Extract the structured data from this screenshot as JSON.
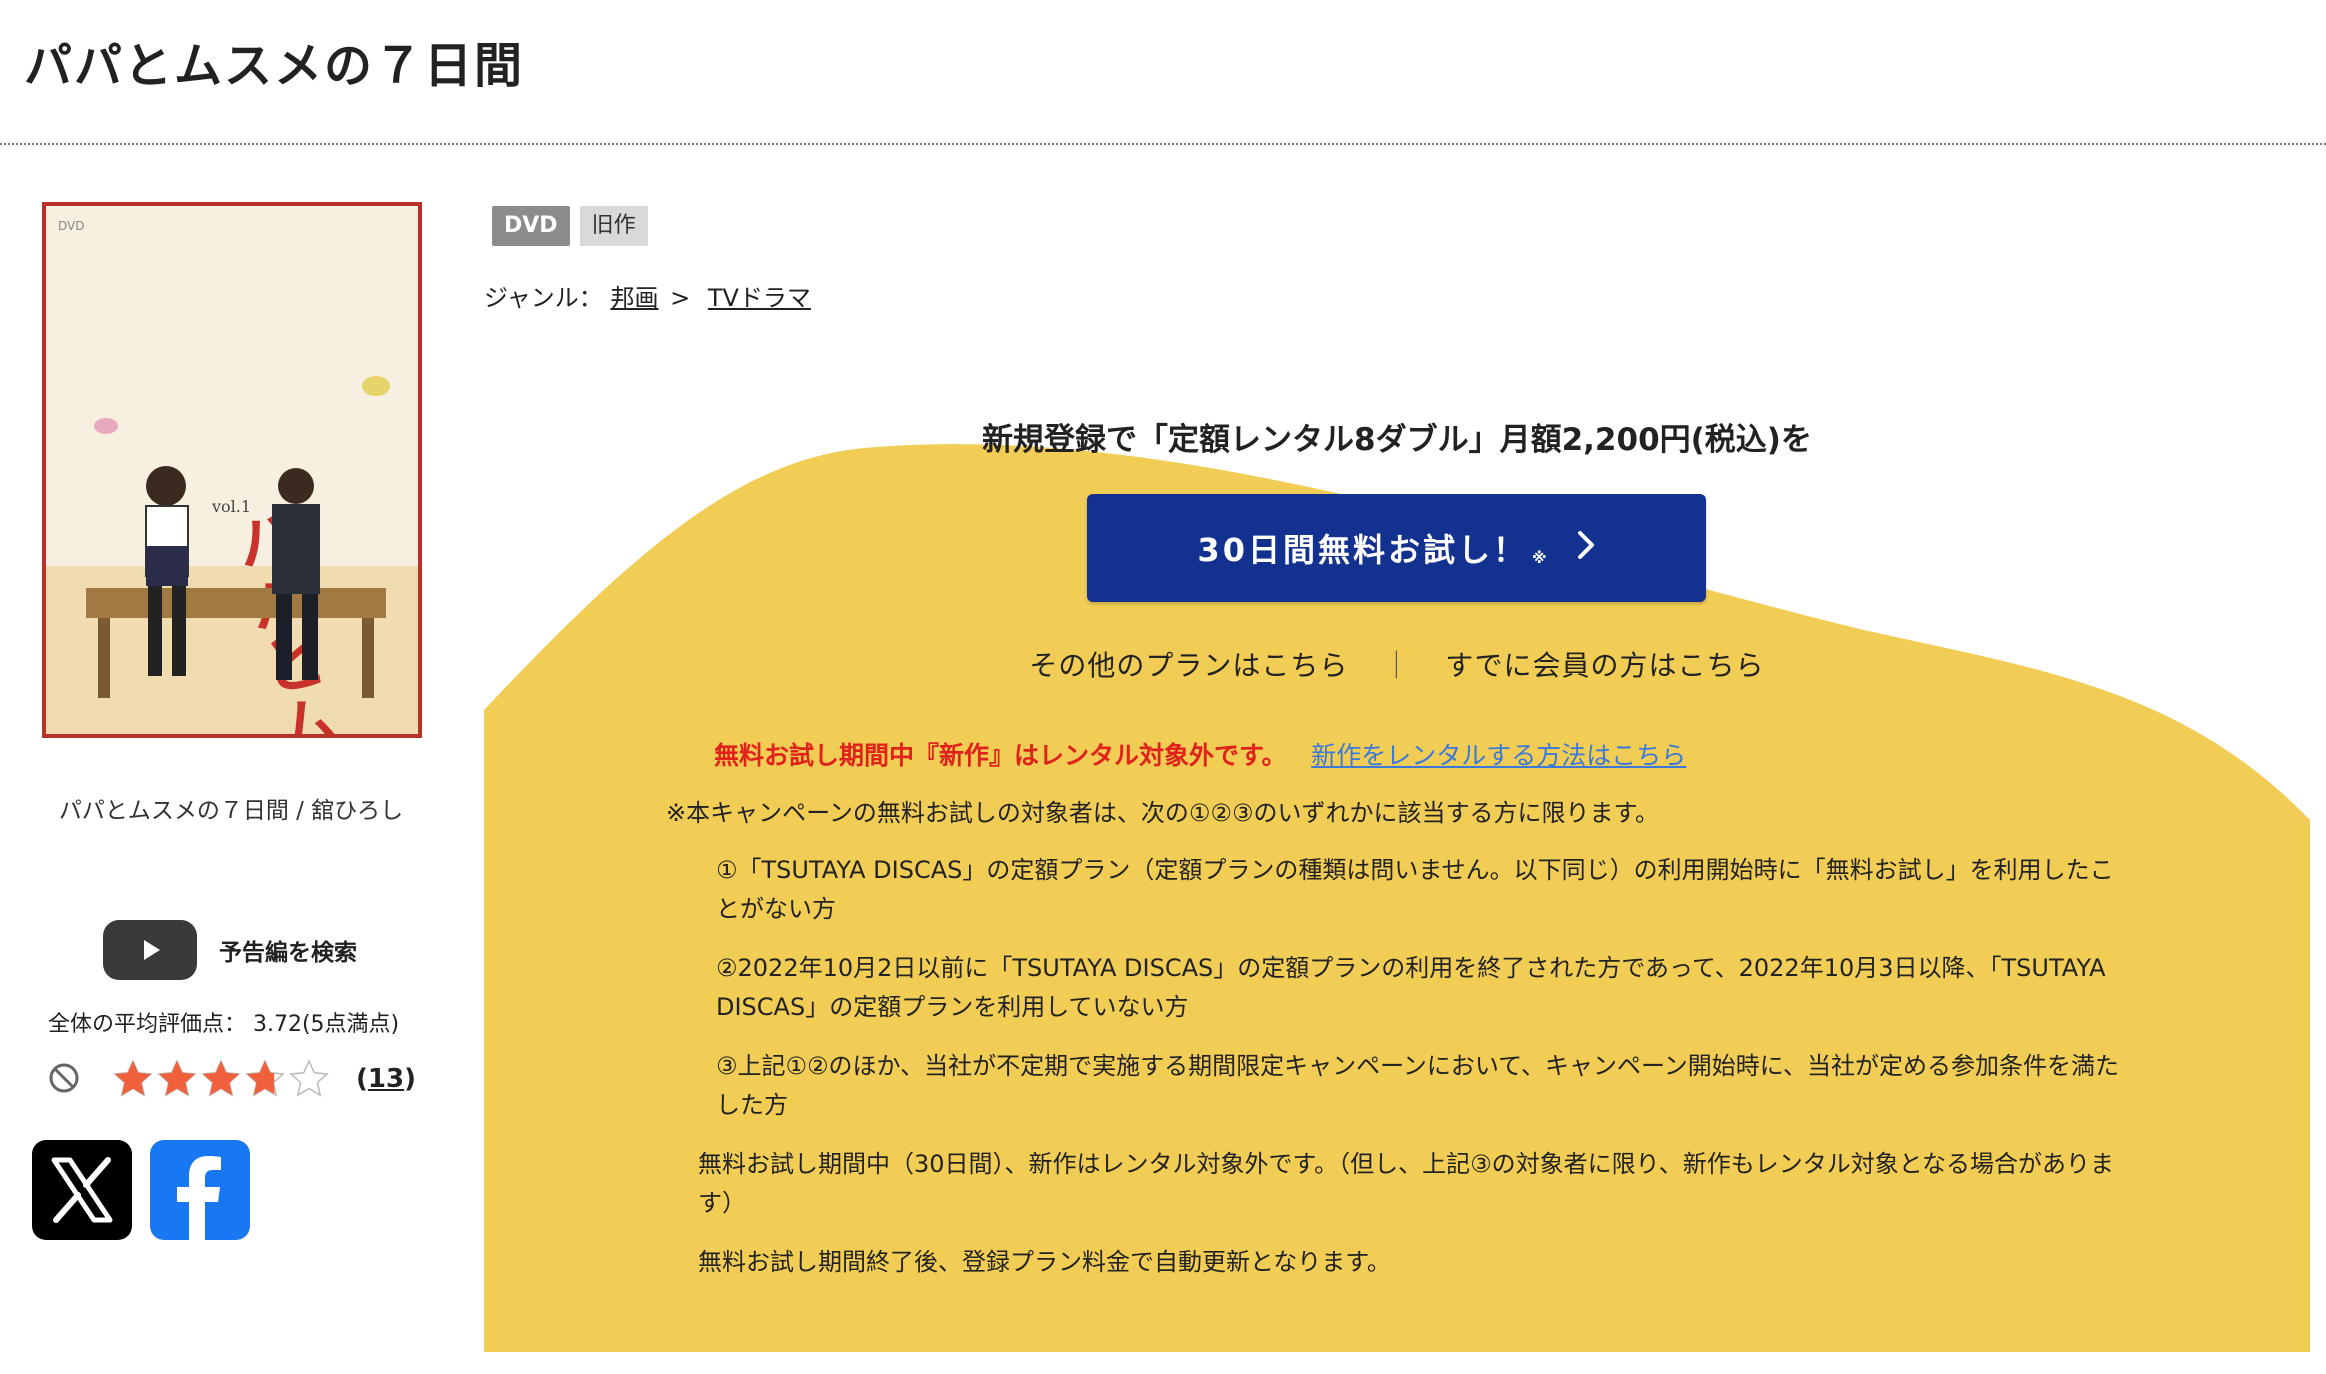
{
  "page": {
    "title": "パパとムスメの７日間"
  },
  "product": {
    "cover": {
      "title_art": "パパとムスメの７日間",
      "volume": "vol.1",
      "format_mark": "DVD"
    },
    "caption": "パパとムスメの７日間 / 舘ひろし",
    "trailer_label": "予告編を検索",
    "rating": {
      "average_text": "全体の平均評価点： 3.72(5点満点)",
      "value": 3.72,
      "max": 5,
      "review_count": "13",
      "count_open": "(",
      "count_close": ")"
    },
    "share": {
      "x_icon": "x-logo-icon",
      "facebook_icon": "facebook-logo-icon"
    }
  },
  "info": {
    "badges": [
      "DVD",
      "旧作"
    ],
    "genre": {
      "label": "ジャンル：",
      "items": [
        "邦画",
        "TVドラマ"
      ],
      "separator": ">"
    }
  },
  "promo": {
    "headline": "新規登録で「定額レンタル8ダブル」月額2,200円(税込)を",
    "cta_label": "30日間無料お試し！",
    "cta_mark": "※",
    "other_plans": "その他のプランはこちら",
    "divider": "｜",
    "member_login": "すでに会員の方はこちら",
    "notice_text": "無料お試し期間中『新作』はレンタル対象外です。",
    "notice_link": "新作をレンタルする方法はこちら",
    "terms_intro": "※本キャンペーンの無料お試しの対象者は、次の①②③のいずれかに該当する方に限ります。",
    "terms_items": [
      "①「TSUTAYA DISCAS」の定額プラン（定額プランの種類は問いません。以下同じ）の利用開始時に「無料お試し」を利用したことがない方",
      "②2022年10月2日以前に「TSUTAYA DISCAS」の定額プランの利用を終了された方であって、2022年10月3日以降、「TSUTAYA DISCAS」の定額プランを利用していない方",
      "③上記①②のほか、当社が不定期で実施する期間限定キャンペーンにおいて、キャンペーン開始時に、当社が定める参加条件を満たした方"
    ],
    "terms_notes": [
      "無料お試し期間中（30日間）、新作はレンタル対象外です。（但し、上記③の対象者に限り、新作もレンタル対象となる場合があります）",
      "無料お試し期間終了後、登録プラン料金で自動更新となります。"
    ]
  },
  "colors": {
    "cta_blue": "#13318f",
    "promo_yellow": "#f2cd55",
    "notice_red": "#e0231a",
    "link_blue": "#3b79d8",
    "star_orange": "#f0603c",
    "facebook_blue": "#1877f2"
  }
}
